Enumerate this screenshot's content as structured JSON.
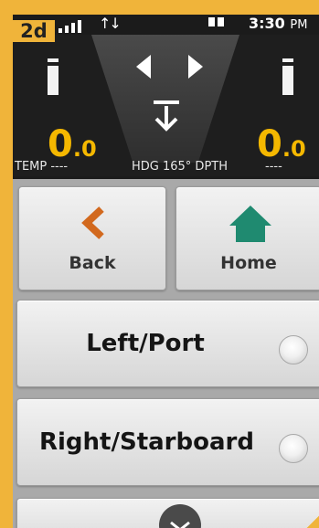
{
  "step_badge": "2d",
  "status": {
    "time": "3:30",
    "ampm": "PM"
  },
  "dash": {
    "left_readout": {
      "whole": "0",
      "decimal": ".0"
    },
    "right_readout": {
      "whole": "0",
      "decimal": ".0"
    }
  },
  "info": {
    "temp": "TEMP ----",
    "heading": "HDG 165° DPTH",
    "depth": "----"
  },
  "buttons": {
    "back": "Back",
    "home": "Home",
    "left_port": "Left/Port",
    "right_starboard": "Right/Starboard"
  },
  "colors": {
    "accent": "#f0b43a",
    "readout": "#f5b800",
    "back_icon": "#d2691e",
    "home_icon": "#1f8a70"
  },
  "icons": {
    "back": "chevron-left-icon",
    "home": "home-icon",
    "more": "chevron-down-icon"
  }
}
